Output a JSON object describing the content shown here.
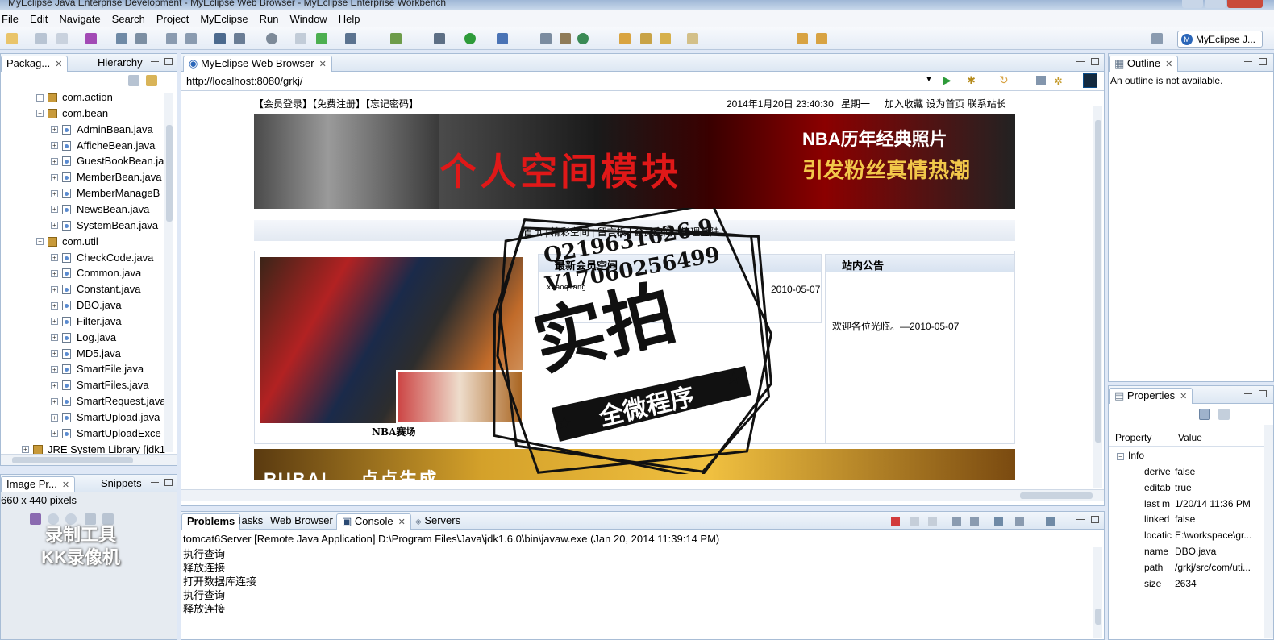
{
  "window": {
    "title": "MyEclipse Java Enterprise Development - MyEclipse Web Browser - MyEclipse Enterprise Workbench"
  },
  "menu": [
    "File",
    "Edit",
    "Navigate",
    "Search",
    "Project",
    "MyEclipse",
    "Run",
    "Window",
    "Help"
  ],
  "perspective": {
    "label": "MyEclipse J..."
  },
  "package_explorer": {
    "tabs": [
      "Packag...",
      "Hierarchy"
    ],
    "tree": [
      {
        "label": "com.action",
        "kind": "package",
        "expanded": false
      },
      {
        "label": "com.bean",
        "kind": "package",
        "expanded": true
      },
      {
        "label": "AdminBean.java",
        "kind": "file"
      },
      {
        "label": "AfficheBean.java",
        "kind": "file"
      },
      {
        "label": "GuestBookBean.ja",
        "kind": "file"
      },
      {
        "label": "MemberBean.java",
        "kind": "file"
      },
      {
        "label": "MemberManageB",
        "kind": "file"
      },
      {
        "label": "NewsBean.java",
        "kind": "file"
      },
      {
        "label": "SystemBean.java",
        "kind": "file"
      },
      {
        "label": "com.util",
        "kind": "package",
        "expanded": true
      },
      {
        "label": "CheckCode.java",
        "kind": "file"
      },
      {
        "label": "Common.java",
        "kind": "file"
      },
      {
        "label": "Constant.java",
        "kind": "file"
      },
      {
        "label": "DBO.java",
        "kind": "file"
      },
      {
        "label": "Filter.java",
        "kind": "file"
      },
      {
        "label": "Log.java",
        "kind": "file"
      },
      {
        "label": "MD5.java",
        "kind": "file"
      },
      {
        "label": "SmartFile.java",
        "kind": "file"
      },
      {
        "label": "SmartFiles.java",
        "kind": "file"
      },
      {
        "label": "SmartRequest.java",
        "kind": "file"
      },
      {
        "label": "SmartUpload.java",
        "kind": "file"
      },
      {
        "label": "SmartUploadExce",
        "kind": "file"
      },
      {
        "label": "JRE System Library [jdk1",
        "kind": "library"
      }
    ]
  },
  "image_preview": {
    "tabs": [
      "Image Pr...",
      "Snippets"
    ],
    "size_text": "660 x 440 pixels"
  },
  "browser": {
    "tab": "MyEclipse Web Browser",
    "url": "http://localhost:8080/grkj/",
    "site": {
      "top_links": "【会员登录】【免费注册】【忘记密码】",
      "datetime": "2014年1月20日  23:40:30",
      "weekday": "星期一",
      "top_right": "加入收藏  设为首页  联系站长",
      "banner_main": "个人空间模块",
      "banner_right_1": "NBA历年经典照片",
      "banner_right_2": "引发粉丝真情热潮",
      "nav": "首页  |  精彩空间  |  留言板  |  会员空间  |  管理登陆",
      "photo_caption": "NBA赛场",
      "new_members_title": "最新会员空间",
      "member_name": "xiaoqiang",
      "member_date": "2010-05-07",
      "notice_title": "站内公告",
      "notice_text": "欢迎各位光临。—2010-05-07",
      "ad_text": "RUBAI   ... 点点生成"
    },
    "overlay": {
      "qq": "Q219631626 9",
      "v": "V17060256499",
      "main": "实拍",
      "sub": "全微程序"
    }
  },
  "outline": {
    "tab": "Outline",
    "message": "An outline is not available."
  },
  "properties": {
    "tab": "Properties",
    "headers": [
      "Property",
      "Value"
    ],
    "group": "Info",
    "rows": [
      {
        "k": "derive",
        "v": "false"
      },
      {
        "k": "editab",
        "v": "true"
      },
      {
        "k": "last m",
        "v": "1/20/14 11:36 PM"
      },
      {
        "k": "linked",
        "v": "false"
      },
      {
        "k": "locatic",
        "v": "E:\\workspace\\gr..."
      },
      {
        "k": "name",
        "v": "DBO.java"
      },
      {
        "k": "path",
        "v": "/grkj/src/com/uti..."
      },
      {
        "k": "size",
        "v": "2634"
      }
    ]
  },
  "console": {
    "tabs": [
      "Problems",
      "Tasks",
      "Web Browser",
      "Console",
      "Servers"
    ],
    "header": "tomcat6Server [Remote Java Application] D:\\Program Files\\Java\\jdk1.6.0\\bin\\javaw.exe (Jan 20, 2014 11:39:14 PM)",
    "lines": [
      "执行查询",
      "释放连接",
      "打开数据库连接",
      "执行查询",
      "释放连接"
    ]
  },
  "watermark": {
    "line1": "录制工具",
    "line2": "KK录像机"
  },
  "colors": {
    "accent": "#2b66b8",
    "banner_red": "#e01818",
    "stamp_black": "#111111"
  }
}
